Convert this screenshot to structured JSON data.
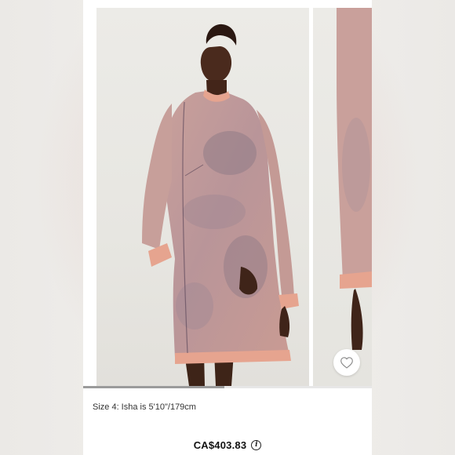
{
  "product": {
    "size_note": "Size 4: Isha is 5'10\"/179cm",
    "price": "CA$403.83"
  },
  "gallery": {
    "progress": 0.49
  },
  "icons": {
    "favorite": "heart-outline-icon",
    "info": "info-icon"
  },
  "colors": {
    "dress": "#c89a94",
    "dress_shadow": "#8f7b86",
    "fringe": "#e6a48f",
    "skin": "#4a2a1d",
    "text": "#333333",
    "price": "#111111"
  }
}
